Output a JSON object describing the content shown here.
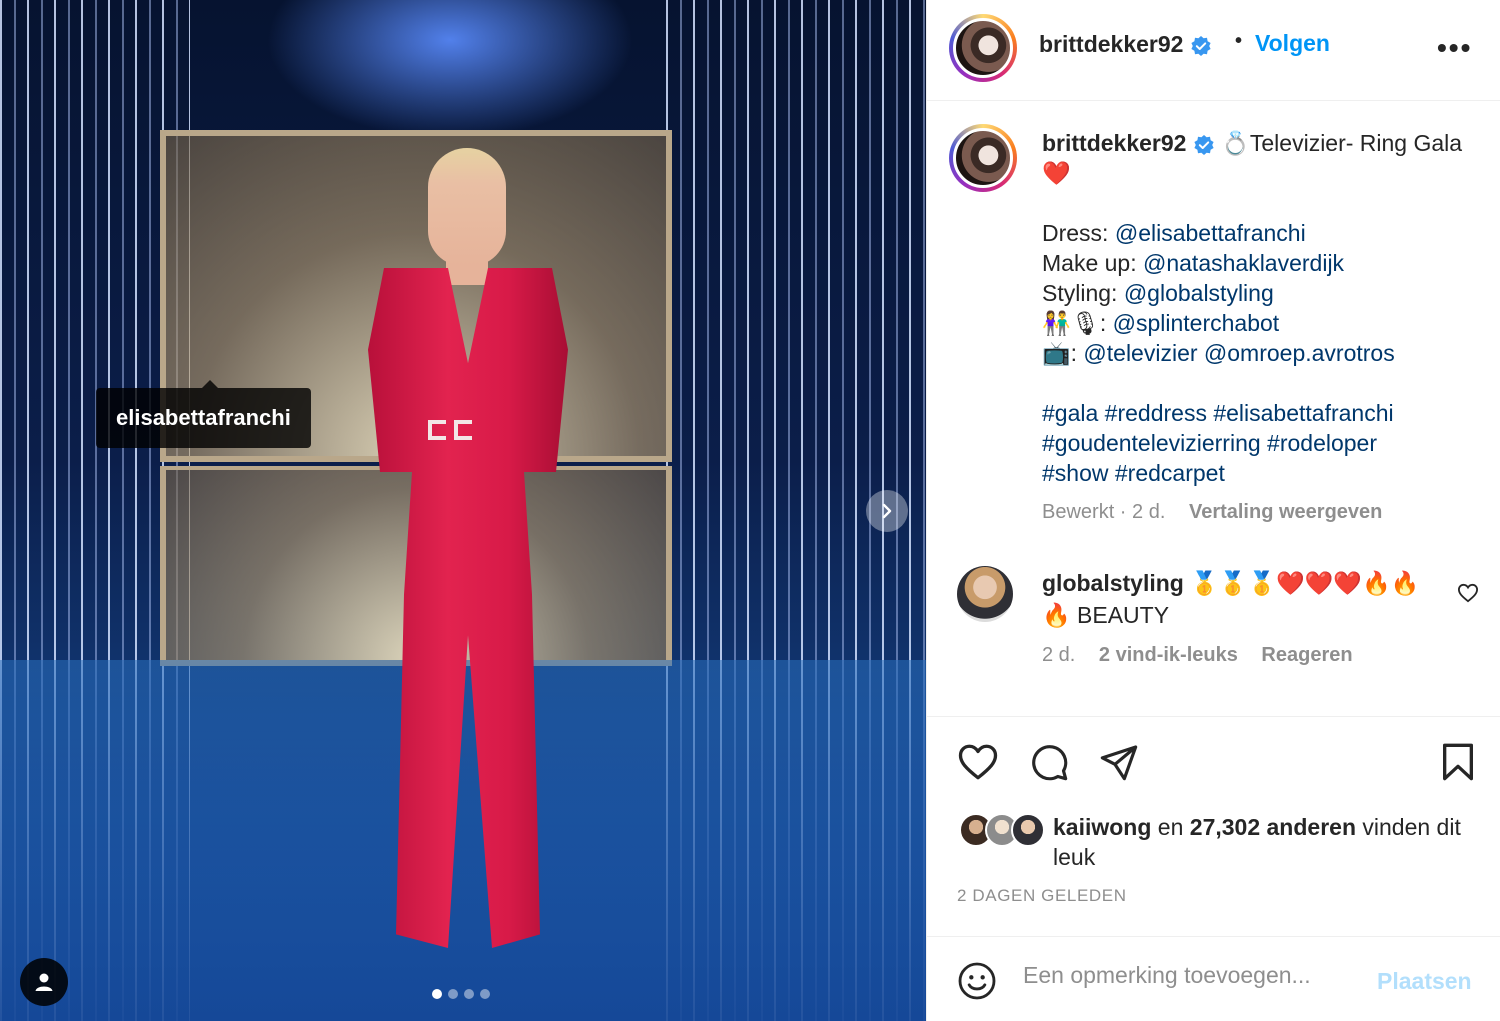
{
  "photo": {
    "tag_label": "elisabettafranchi",
    "carousel": {
      "slides": 4,
      "active_index": 0
    }
  },
  "header": {
    "username": "brittdekker92",
    "separator": "•",
    "follow_label": "Volgen",
    "more_label": "•••"
  },
  "caption": {
    "username": "brittdekker92",
    "lines": [
      "💍Televizier- Ring Gala ❤️"
    ],
    "credits": [
      {
        "label": "Dress: ",
        "mentions": [
          "@elisabettafranchi"
        ]
      },
      {
        "label": "Make up: ",
        "mentions": [
          "@natashaklaverdijk"
        ]
      },
      {
        "label": "Styling: ",
        "mentions": [
          "@globalstyling"
        ]
      },
      {
        "label": "👫🎙: ",
        "mentions": [
          "@splinterchabot"
        ]
      },
      {
        "label": "📺: ",
        "mentions": [
          "@televizier",
          "@omroep.avrotros"
        ]
      }
    ],
    "hashtag_lines": [
      "#gala #reddress #elisabettafranchi",
      "#goudentelevizierring #rodeloper",
      "#show #redcarpet"
    ],
    "edited": "Bewerkt · 2 d.",
    "translate_label": "Vertaling weergeven"
  },
  "comment": {
    "username": "globalstyling",
    "text": " 🥇🥇🥇❤️❤️❤️🔥🔥🔥 BEAUTY",
    "age": "2 d.",
    "likes": "2 vind-ik-leuks",
    "reply_label": "Reageren"
  },
  "likes": {
    "first_user": "kaiiwong",
    "connector": " en ",
    "count_text": "27,302 anderen",
    "suffix": " vinden dit leuk"
  },
  "date_label": "2 DAGEN GELEDEN",
  "comment_box": {
    "placeholder": "Een opmerking toevoegen...",
    "post_label": "Plaatsen"
  },
  "colors": {
    "accent": "#0095f6",
    "link": "#00376b",
    "muted": "#8e8e8e",
    "post_disabled": "#b2dffc",
    "verified": "#3897f0"
  }
}
